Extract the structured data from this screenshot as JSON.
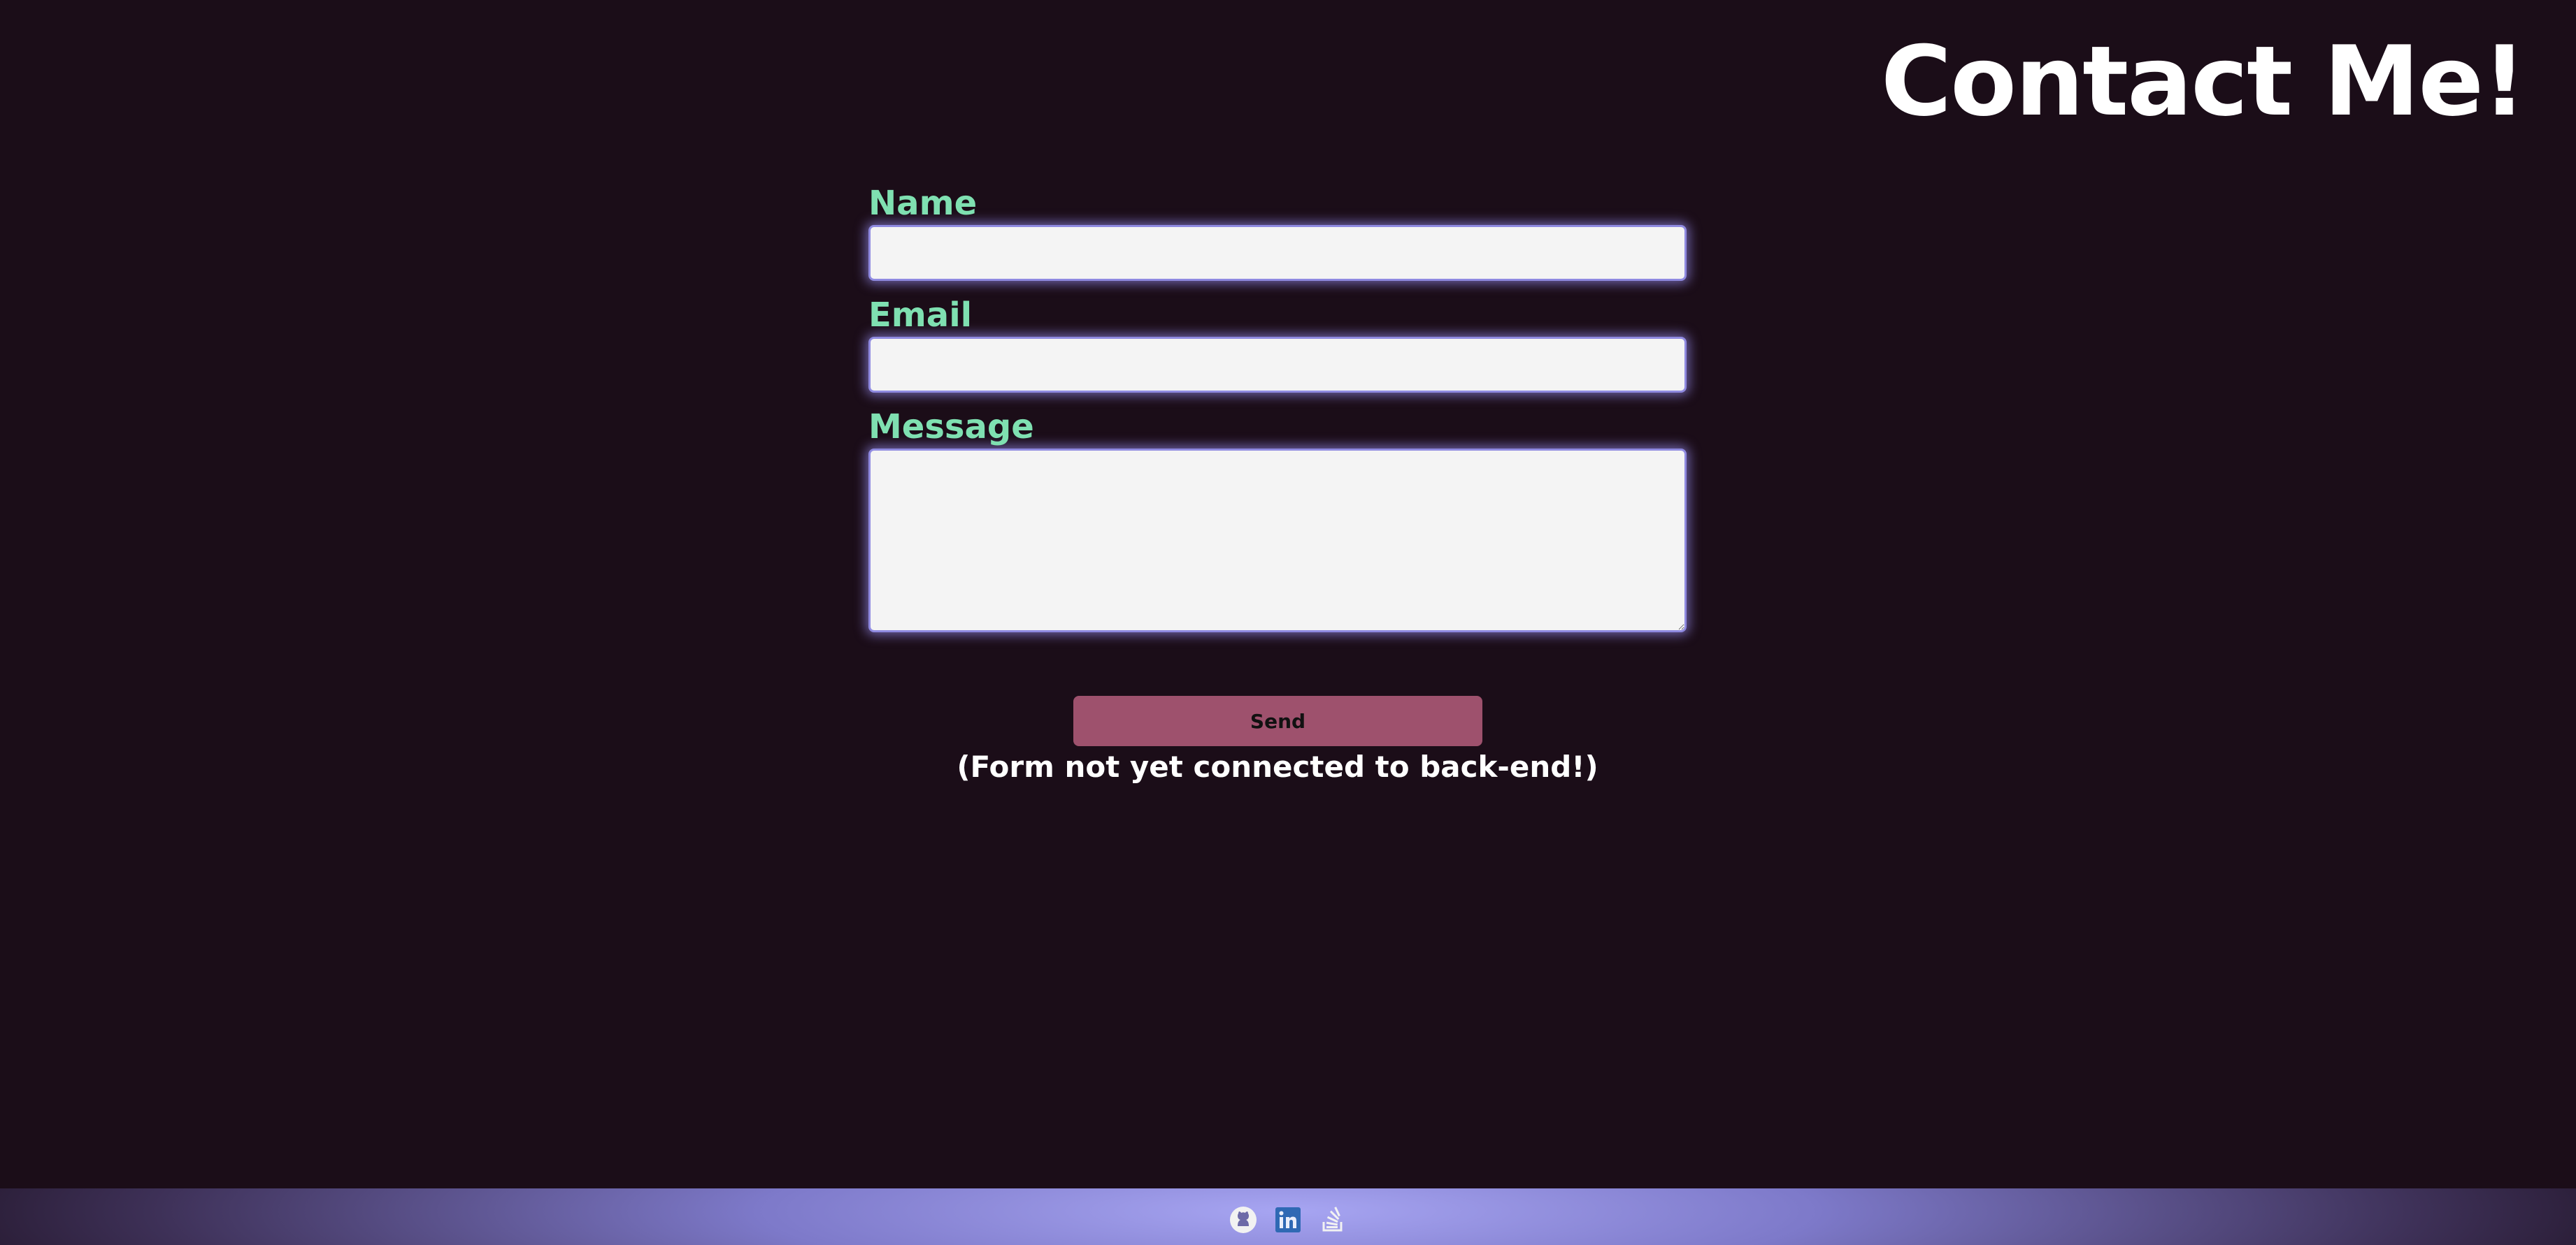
{
  "header": {
    "title": "Contact Me!"
  },
  "form": {
    "name_label": "Name",
    "name_value": "",
    "email_label": "Email",
    "email_value": "",
    "message_label": "Message",
    "message_value": "",
    "send_label": "Send",
    "note": "(Form not yet connected to back-end!)"
  },
  "footer": {
    "links": [
      {
        "icon": "github-icon"
      },
      {
        "icon": "linkedin-icon"
      },
      {
        "icon": "stackoverflow-icon"
      }
    ]
  },
  "colors": {
    "background": "#1b0d18",
    "label": "#7fe0b1",
    "button": "#9e516d",
    "input_glow": "#8f8ae0",
    "footer_center": "#a7a5f2"
  }
}
